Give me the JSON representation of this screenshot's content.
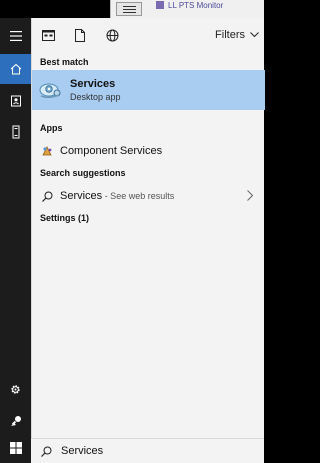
{
  "background_window": {
    "title": "LL PTS Monitor"
  },
  "rail": {
    "items": [
      {
        "icon": "hamburger-icon"
      },
      {
        "icon": "home-icon",
        "active": true
      },
      {
        "icon": "contact-card-icon"
      },
      {
        "icon": "tower-device-icon"
      },
      {
        "icon": "gear-icon"
      },
      {
        "icon": "feedback-icon"
      },
      {
        "icon": "windows-start-icon"
      }
    ],
    "accent": "#2d6fbd"
  },
  "topbar": {
    "icons": [
      "apps-filter-icon",
      "documents-filter-icon",
      "web-filter-icon"
    ],
    "filters_label": "Filters"
  },
  "sections": {
    "best_match_label": "Best match",
    "apps_label": "Apps",
    "search_suggestions_label": "Search suggestions",
    "settings_label": "Settings (1)"
  },
  "best_match": {
    "title": "Services",
    "subtitle": "Desktop app",
    "highlight_color": "#a9cdf1"
  },
  "apps": [
    {
      "label": "Component Services"
    }
  ],
  "suggestions": [
    {
      "label": "Services",
      "suffix": " - See web results"
    }
  ],
  "search": {
    "value": "Services"
  }
}
